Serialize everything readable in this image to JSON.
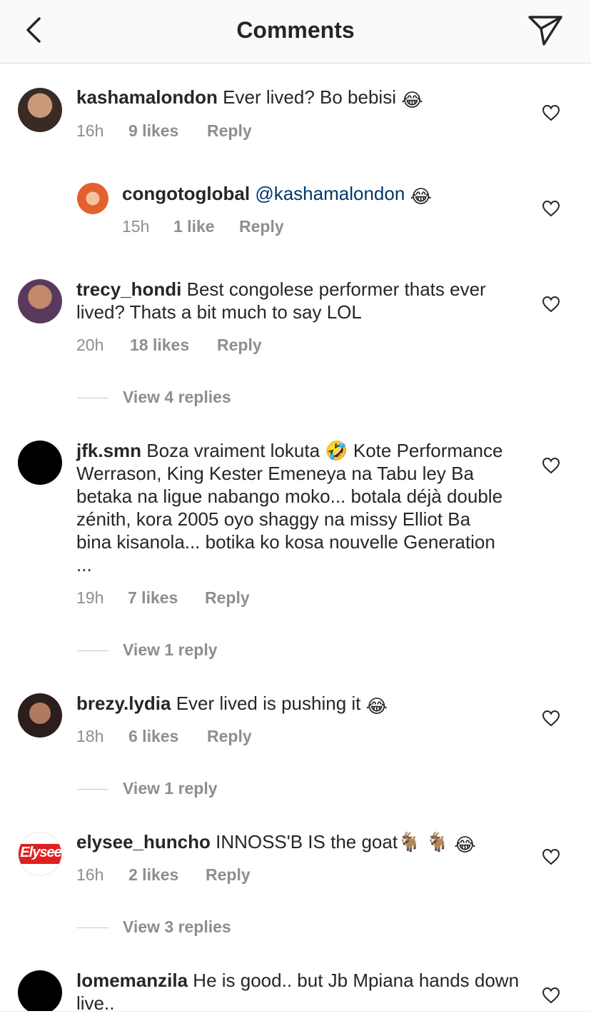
{
  "header": {
    "title": "Comments"
  },
  "comments": [
    {
      "user": "kashamalondon",
      "mention": "",
      "text": "Ever lived? Bo bebisi",
      "emoji": "😂",
      "time": "16h",
      "likes": "9 likes",
      "reply": "Reply"
    },
    {
      "user": "congotoglobal",
      "mention": "@kashamalondon",
      "text": "",
      "emoji": "😂",
      "time": "15h",
      "likes": "1 like",
      "reply": "Reply"
    },
    {
      "user": "trecy_hondi",
      "mention": "",
      "text": "Best congolese performer thats ever lived? Thats a bit much to say LOL",
      "emoji": "",
      "time": "20h",
      "likes": "18 likes",
      "reply": "Reply"
    },
    {
      "user": "jfk.smn",
      "mention": "",
      "text": "Boza vraiment lokuta 🤣 Kote Performance Werrason, King Kester Emeneya na Tabu ley Ba betaka na ligue nabango moko... botala déjà double zénith, kora 2005 oyo shaggy na missy Elliot Ba bina kisanola... botika ko kosa nouvelle Generation ...",
      "emoji": "",
      "time": "19h",
      "likes": "7 likes",
      "reply": "Reply"
    },
    {
      "user": "brezy.lydia",
      "mention": "",
      "text": "Ever lived is pushing it",
      "emoji": "😂",
      "time": "18h",
      "likes": "6 likes",
      "reply": "Reply"
    },
    {
      "user": "elysee_huncho",
      "mention": "",
      "text": "INNOSS'B IS the goat🐐 🐐",
      "emoji": "😂",
      "time": "16h",
      "likes": "2 likes",
      "reply": "Reply"
    },
    {
      "user": "lomemanzila",
      "mention": "",
      "text": "He is good.. but Jb Mpiana hands down live..",
      "emoji": "",
      "time": "",
      "likes": "",
      "reply": ""
    }
  ],
  "view_replies": [
    "View 4 replies",
    "View 1 reply",
    "View 1 reply",
    "View 3 replies"
  ],
  "avatar_labels": {
    "elysee": "Elysee"
  },
  "icons": {
    "back": "chevron-left-icon",
    "send": "paper-plane-icon",
    "like": "heart-outline-icon"
  },
  "colors": {
    "mention": "#00376b",
    "meta": "#8e8e8e",
    "text": "#262626",
    "header_bg": "#fafafa"
  }
}
